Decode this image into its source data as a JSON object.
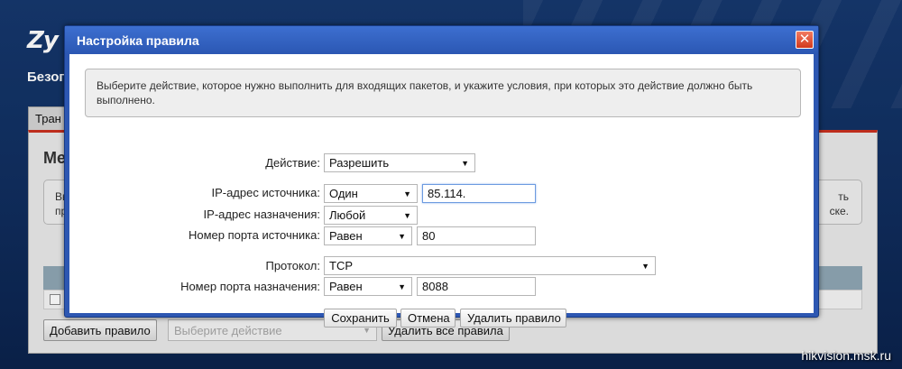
{
  "background": {
    "logo": "Zy",
    "section_title": "Безоп",
    "tab_label": "Тран",
    "heading": "Ме",
    "info_left_lines": [
      "Вы",
      "пр"
    ],
    "info_right_lines": [
      "ть",
      "ске."
    ],
    "add_rule_button": "Добавить правило",
    "action_select_placeholder": "Выберите действие",
    "delete_all_button": "Удалить все правила"
  },
  "dialog": {
    "title": "Настройка правила",
    "close_icon": "close-icon",
    "hint": "Выберите действие, которое нужно выполнить для входящих пакетов, и укажите условия, при которых это действие должно быть выполнено.",
    "fields": {
      "action": {
        "label": "Действие:",
        "value": "Разрешить"
      },
      "source_ip": {
        "label": "IP-адрес источника:",
        "mode": "Один",
        "value": "85.114."
      },
      "dest_ip": {
        "label": "IP-адрес назначения:",
        "mode": "Любой"
      },
      "source_port": {
        "label": "Номер порта источника:",
        "mode": "Равен",
        "value": "80"
      },
      "protocol": {
        "label": "Протокол:",
        "value": "TCP"
      },
      "dest_port": {
        "label": "Номер порта назначения:",
        "mode": "Равен",
        "value": "8088"
      }
    },
    "buttons": {
      "save": "Сохранить",
      "cancel": "Отмена",
      "delete_rule": "Удалить правило"
    }
  },
  "watermark": "hikvision.msk.ru",
  "colors": {
    "titlebar": "#2d57b2",
    "close_button": "#d2391d",
    "accent_red": "#c9301f",
    "table_header": "#8fa6b4"
  }
}
